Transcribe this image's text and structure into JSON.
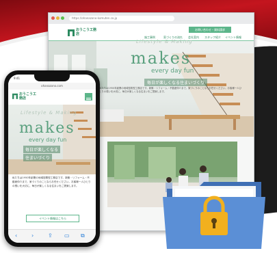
{
  "desktop": {
    "url": "https://ohanazono-komuten.co.jp",
    "brand": "おうこう工務店",
    "contact_label": "お問い合わせ・資料請求",
    "nav": [
      "施工事例",
      "家づくりの流れ",
      "会社案内",
      "スタッフ紹介",
      "イベント情報"
    ],
    "hero": {
      "arc_text": "Lifestyle & Making",
      "title": "makes",
      "subtitle": "every day fun",
      "tagline": "毎日が楽しくなる住まいづくり",
      "body": "私たちは1950年創業の地域密着型工務店です。新築・リフォーム・不動産仲介まで、家づくりのことならお任せください。お客様一人ひとりの想いを大切に、毎日が楽しくなる住まいをご提案します。"
    }
  },
  "phone": {
    "time": "9:41",
    "url": "ohanazono.com",
    "brand": "おうこう工務店",
    "hero": {
      "arc_text": "Lifestyle & Making",
      "title": "makes",
      "subtitle": "every day fun",
      "tagline_line1": "毎日が楽しくなる",
      "tagline_line2": "住まいづくり"
    },
    "body": "私たちは1950年創業の地域密着型工務店です。新築・リフォーム・不動産仲介まで、家づくりのことならお任せください。お客様一人ひとりの想いを大切に、毎日が楽しくなる住まいをご提案します。",
    "button_label": "イベント情報はこちら",
    "toolbar": [
      "‹",
      "›",
      "⇪",
      "▭",
      "⧉"
    ]
  },
  "icons": {
    "folder": "folder-icon",
    "lock": "padlock-icon"
  },
  "colors": {
    "brand_green": "#2c8a60",
    "accent_green": "#5cb58a",
    "swoosh_red": "#b5121b",
    "folder_blue": "#5b8fd6",
    "lock_yellow": "#f2b01e"
  }
}
